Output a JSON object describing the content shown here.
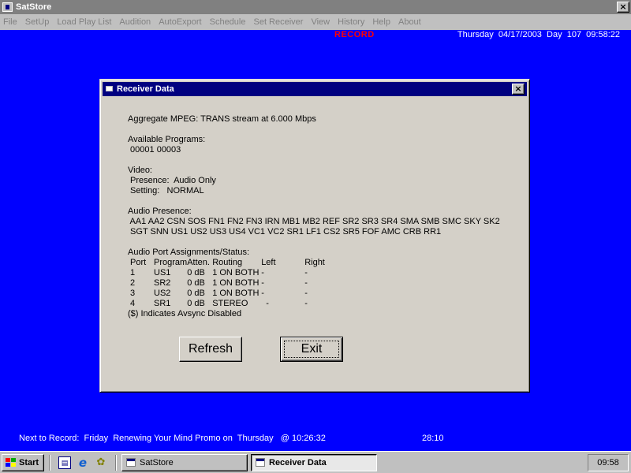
{
  "app": {
    "title": "SatStore"
  },
  "menu": [
    "File",
    "SetUp",
    "Load Play List",
    "Audition",
    "AutoExport",
    "Schedule",
    "Set Receiver",
    "View",
    "History",
    "Help",
    "About"
  ],
  "status": {
    "record": "RECORD",
    "datetime": "Thursday  04/17/2003  Day  107  09:58:22"
  },
  "dialog": {
    "title": "Receiver Data",
    "aggregate": "Aggregate MPEG: TRANS stream at 6.000 Mbps",
    "programs_label": "Available Programs:",
    "programs_value": " 00001 00003",
    "video_label": "Video:",
    "video_presence": " Presence:  Audio Only",
    "video_setting": " Setting:   NORMAL",
    "audio_presence_label": "Audio Presence:",
    "audio_presence_line1": " AA1 AA2 CSN SOS FN1 FN2 FN3 IRN MB1 MB2 REF SR2 SR3 SR4 SMA SMB SMC SKY SK2",
    "audio_presence_line2": " SGT SNN US1 US2 US3 US4 VC1 VC2 SR1 LF1 CS2 SR5 FOF AMC CRB RR1",
    "ports_label": "Audio Port Assignments/Status:",
    "ports_headers": [
      "Port",
      "Program",
      "Atten.",
      "Routing",
      "Left",
      "Right"
    ],
    "ports_rows": [
      [
        "1",
        "US1",
        "0 dB",
        "1 ON BOTH",
        "-",
        "-"
      ],
      [
        "2",
        "SR2",
        "0 dB",
        "1 ON BOTH",
        "-",
        "-"
      ],
      [
        "3",
        "US2",
        "0 dB",
        "1 ON BOTH",
        "-",
        "-"
      ],
      [
        "4",
        "SR1",
        "0 dB",
        "STEREO",
        "  -",
        "-"
      ]
    ],
    "avsync_note": "($) Indicates Avsync Disabled",
    "refresh_label": "Refresh",
    "exit_label": "Exit"
  },
  "footer": {
    "next_record": "Next to Record:  Friday  Renewing Your Mind Promo on  Thursday   @ 10:26:32",
    "countdown": "28:10"
  },
  "taskbar": {
    "start_label": "Start",
    "tasks": [
      "SatStore",
      "Receiver Data"
    ],
    "clock": "09:58"
  },
  "icons": {
    "app": "satstore-app-icon",
    "start": "windows-logo-icon",
    "quick_launch": [
      "show-desktop-icon",
      "internet-explorer-icon",
      "channel-bar-icon"
    ]
  },
  "colors": {
    "desktop": "#0000ff",
    "dialog_title": "#000080",
    "record": "#ff0000"
  }
}
